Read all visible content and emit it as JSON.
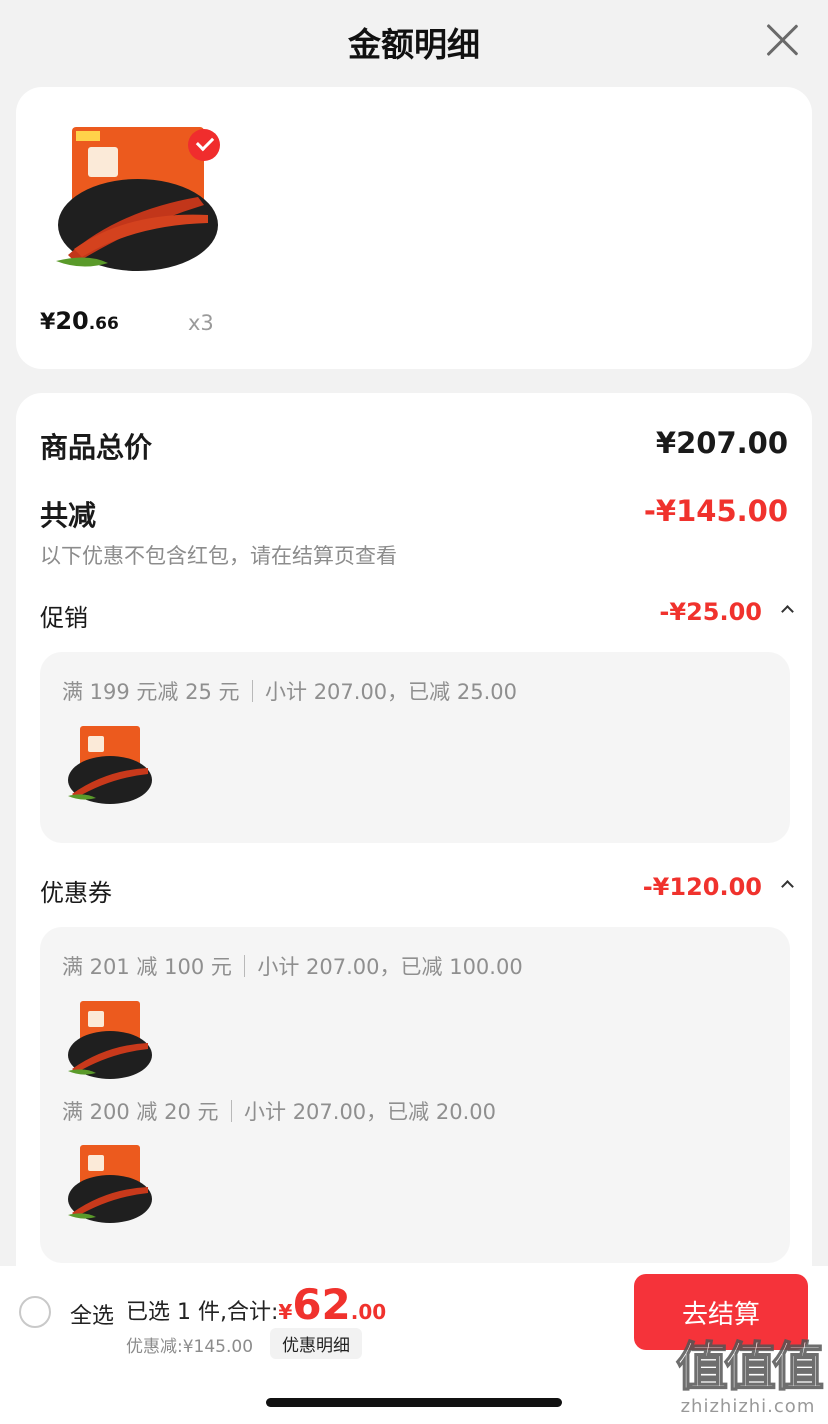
{
  "header": {
    "title": "金额明细"
  },
  "product": {
    "price_symbol": "¥",
    "price_int": "20",
    "price_dec": ".66",
    "quantity": "x3"
  },
  "summary": {
    "total_label": "商品总价",
    "total_value": "¥207.00",
    "reduce_label": "共减",
    "reduce_value": "-¥145.00",
    "note": "以下优惠不包含红包，请在结算页查看"
  },
  "promotion": {
    "label": "促销",
    "value": "-¥25.00",
    "rules": [
      {
        "condition": "满 199 元减 25 元",
        "detail": "小计 207.00，已减 25.00"
      }
    ]
  },
  "coupon": {
    "label": "优惠券",
    "value": "-¥120.00",
    "rules": [
      {
        "condition": "满 201 减 100 元",
        "detail": "小计 207.00，已减 100.00"
      },
      {
        "condition": "满 200 减 20 元",
        "detail": "小计 207.00，已减 20.00"
      }
    ]
  },
  "bottom_bar": {
    "select_all": "全选",
    "selected_text": "已选 1 件,合计:",
    "currency": "¥",
    "amount": "62",
    "cents": ".00",
    "discount_text": "优惠减:¥145.00",
    "detail_link": "优惠明细",
    "checkout": "去结算"
  },
  "watermark": {
    "big": "值值值",
    "small": "zhizhizhi.com"
  },
  "colors": {
    "accent_red": "#f0322d",
    "button_red": "#f5333a",
    "background": "#f2f2f2"
  }
}
